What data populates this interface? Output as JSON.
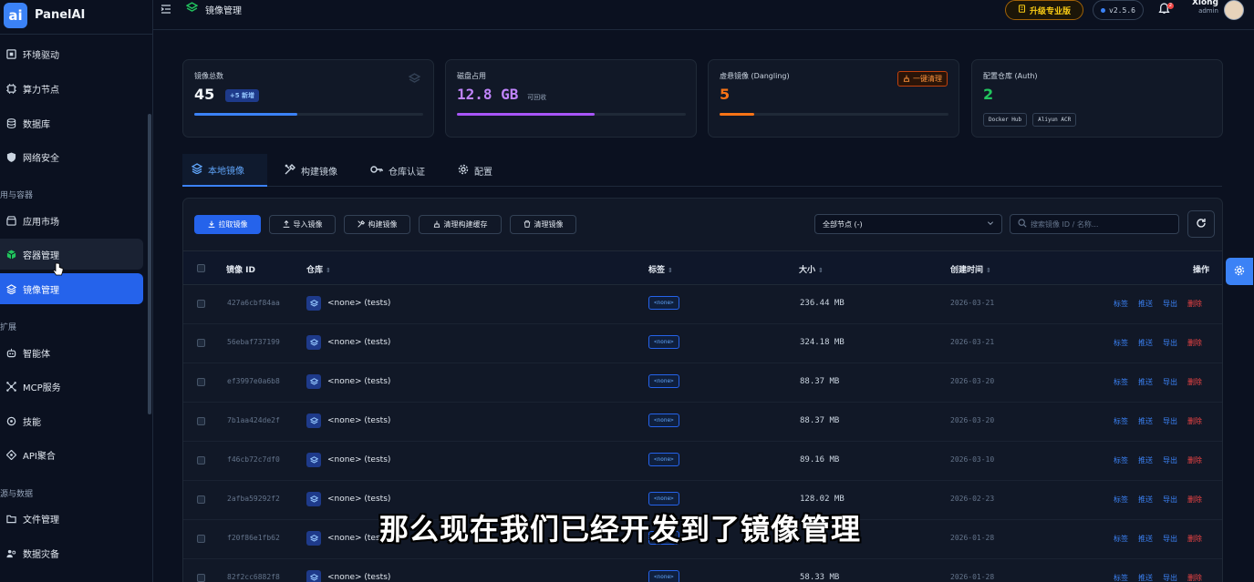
{
  "app": {
    "logo_text": "ai",
    "name": "PanelAI"
  },
  "sidebar": {
    "items_top": [
      {
        "label": "环境驱动",
        "icon": "chip-icon"
      },
      {
        "label": "算力节点",
        "icon": "cpu-icon"
      },
      {
        "label": "数据库",
        "icon": "database-icon"
      },
      {
        "label": "网络安全",
        "icon": "shield-icon"
      }
    ],
    "section_apps": "用与容器",
    "items_apps": [
      {
        "label": "应用市场",
        "icon": "store-icon"
      },
      {
        "label": "容器管理",
        "icon": "cube-icon"
      },
      {
        "label": "镜像管理",
        "icon": "layers-icon"
      }
    ],
    "section_ext": "扩展",
    "items_ext": [
      {
        "label": "智能体",
        "icon": "robot-icon"
      },
      {
        "label": "MCP服务",
        "icon": "network-icon"
      },
      {
        "label": "技能",
        "icon": "brain-icon"
      },
      {
        "label": "API聚合",
        "icon": "api-icon"
      }
    ],
    "section_data": "源与数据",
    "items_data": [
      {
        "label": "文件管理",
        "icon": "folder-icon"
      },
      {
        "label": "数据灾备",
        "icon": "backup-icon"
      }
    ]
  },
  "header": {
    "breadcrumb": "镜像管理",
    "upgrade_label": "升级专业版",
    "version": "v2.5.6",
    "notification_count": "2",
    "user_name": "Xiong",
    "user_role": "admin"
  },
  "stats": {
    "total": {
      "label": "镜像总数",
      "value": "45",
      "chip": "+5 新增",
      "progress": 0.5
    },
    "disk": {
      "label": "磁盘占用",
      "value": "12.8 GB",
      "sub": "可回收",
      "progress": 0.6
    },
    "dangling": {
      "label": "虚悬镜像 (Dangling)",
      "value": "5",
      "action": "一键清理",
      "progress": 0.15
    },
    "auth": {
      "label": "配置仓库 (Auth)",
      "value": "2",
      "registries": [
        "Docker Hub",
        "Aliyun ACR"
      ]
    }
  },
  "tabs": [
    "本地镜像",
    "构建镜像",
    "仓库认证",
    "配置"
  ],
  "toolbar": {
    "pull": "拉取镜像",
    "import": "导入镜像",
    "build": "构建镜像",
    "clear_cache": "清理构建缓存",
    "prune": "清理镜像",
    "node_select": "全部节点 (-)",
    "search_placeholder": "搜索镜像 ID / 名称..."
  },
  "table": {
    "headers": {
      "id": "镜像 ID",
      "repo": "仓库",
      "tag": "标签",
      "size": "大小",
      "created": "创建时间",
      "actions": "操作"
    },
    "action_labels": {
      "tag": "标签",
      "push": "推送",
      "export": "导出",
      "delete": "删除"
    },
    "rows": [
      {
        "id": "427a6cbf84aa",
        "repo": "<none> (tests)",
        "tag": "<none>",
        "size": "236.44 MB",
        "created": "2026-03-21"
      },
      {
        "id": "56ebaf737199",
        "repo": "<none> (tests)",
        "tag": "<none>",
        "size": "324.18 MB",
        "created": "2026-03-21"
      },
      {
        "id": "ef3997e0a6b8",
        "repo": "<none> (tests)",
        "tag": "<none>",
        "size": "88.37 MB",
        "created": "2026-03-20"
      },
      {
        "id": "7b1aa424de2f",
        "repo": "<none> (tests)",
        "tag": "<none>",
        "size": "88.37 MB",
        "created": "2026-03-20"
      },
      {
        "id": "f46cb72c7df0",
        "repo": "<none> (tests)",
        "tag": "<none>",
        "size": "89.16 MB",
        "created": "2026-03-10"
      },
      {
        "id": "2afba59292f2",
        "repo": "<none> (tests)",
        "tag": "<none>",
        "size": "128.02 MB",
        "created": "2026-02-23"
      },
      {
        "id": "f20f86e1fb62",
        "repo": "<none> (tests)",
        "tag": "<none>",
        "size": "",
        "created": "2026-01-28"
      },
      {
        "id": "82f2cc6882f8",
        "repo": "<none> (tests)",
        "tag": "<none>",
        "size": "58.33 MB",
        "created": "2026-01-28"
      }
    ]
  },
  "subtitle": "那么现在我们已经开发到了镜像管理",
  "colors": {
    "accent": "#2563eb",
    "danger": "#ef4444",
    "warning": "#f97316",
    "success": "#22c55e",
    "purple": "#a855f7"
  }
}
